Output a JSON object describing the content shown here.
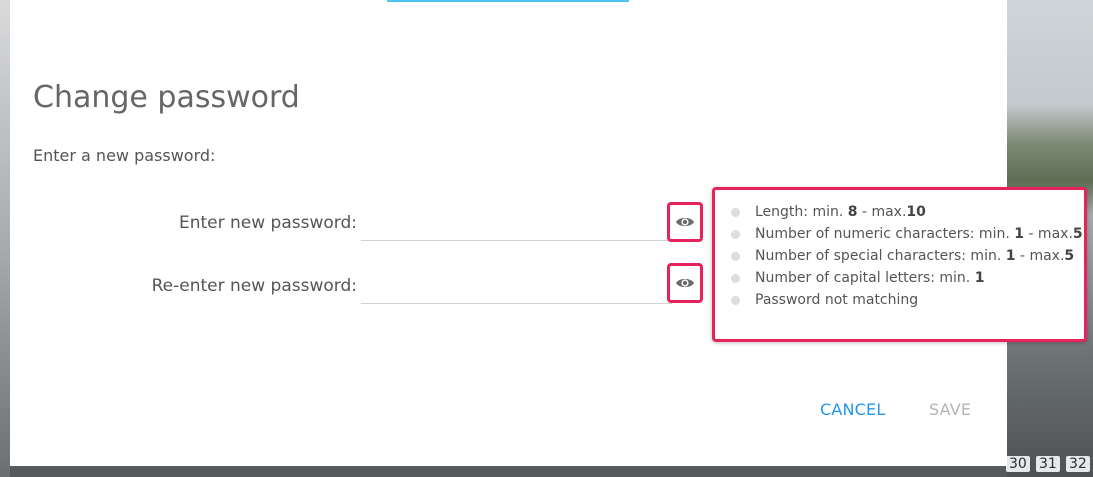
{
  "dialog": {
    "title": "Change password",
    "subtitle": "Enter a new password:"
  },
  "fields": {
    "new_password": {
      "label": "Enter new password:",
      "value": ""
    },
    "confirm_password": {
      "label": "Re-enter new password:",
      "value": ""
    }
  },
  "rules": {
    "length": {
      "prefix": "Length: min. ",
      "min": "8",
      "mid": " - max.",
      "max": "10"
    },
    "numeric": {
      "prefix": "Number of numeric characters: min. ",
      "min": "1",
      "mid": " - max.",
      "max": "5"
    },
    "special": {
      "prefix": "Number of special characters: min. ",
      "min": "1",
      "mid": " - max.",
      "max": "5"
    },
    "capital": {
      "prefix": "Number of capital letters: min. ",
      "min": "1"
    },
    "matching": {
      "text": "Password not matching"
    }
  },
  "buttons": {
    "cancel": "CANCEL",
    "save": "SAVE"
  },
  "background": {
    "numbers": [
      "30",
      "31",
      "32"
    ]
  },
  "colors": {
    "highlight": "#e6245b",
    "accent": "#2196f3",
    "disabled": "#b4b4b4"
  },
  "icons": {
    "show_password": "eye-icon"
  }
}
